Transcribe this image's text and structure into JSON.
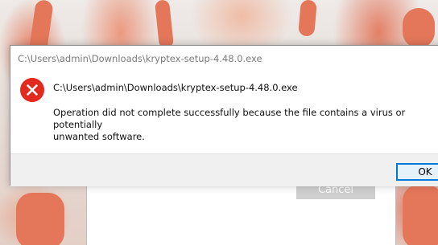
{
  "dialog": {
    "title": "C:\\Users\\admin\\Downloads\\kryptex-setup-4.48.0.exe",
    "main_instruction": "C:\\Users\\admin\\Downloads\\kryptex-setup-4.48.0.exe",
    "message_line1": "Operation did not complete successfully because the file contains a virus or potentially",
    "message_line2": "unwanted software.",
    "ok_label": "OK",
    "icon": "error-icon"
  },
  "background_dialog": {
    "cancel_label": "Cancel"
  },
  "colors": {
    "error_red": "#e22a1f",
    "button_focus_border": "#0078d7",
    "button_background": "#e5f1fb",
    "footer_background": "#f0f0f0"
  }
}
